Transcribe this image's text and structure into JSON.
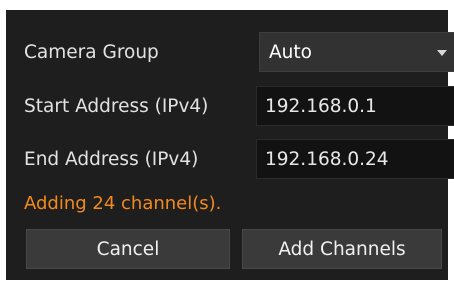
{
  "form": {
    "camera_group": {
      "label": "Camera Group",
      "value": "Auto"
    },
    "start_address": {
      "label": "Start Address (IPv4)",
      "value": "192.168.0.1"
    },
    "end_address": {
      "label": "End Address (IPv4)",
      "value": "192.168.0.24"
    }
  },
  "status": {
    "message": "Adding 24 channel(s).",
    "color": "#f28a1e"
  },
  "buttons": {
    "cancel": "Cancel",
    "add": "Add Channels"
  },
  "icons": {
    "dropdown": "chevron-down-icon"
  }
}
